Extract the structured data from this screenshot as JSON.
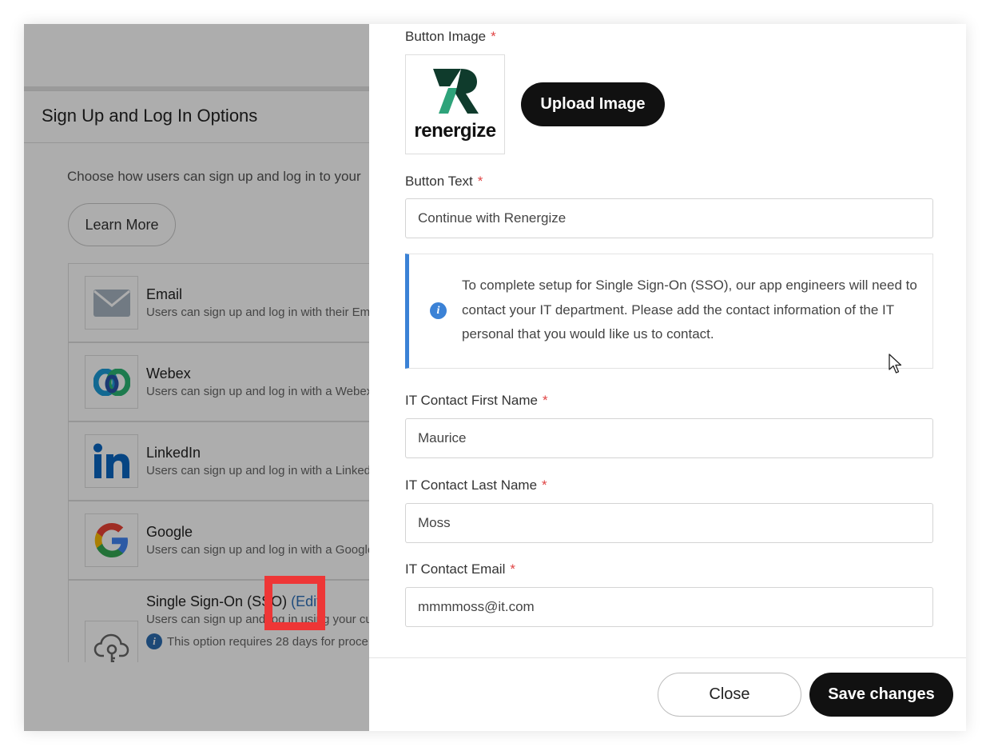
{
  "background_page": {
    "card_title": "Sign Up and Log In Options",
    "description": "Choose how users can sign up and log in to your",
    "learn_more_label": "Learn More",
    "providers": [
      {
        "name": "Email",
        "description": "Users can sign up and log in with their Ema",
        "icon": "envelope-icon"
      },
      {
        "name": "Webex",
        "description": "Users can sign up and log in with a Webex",
        "icon": "webex-icon"
      },
      {
        "name": "LinkedIn",
        "description": "Users can sign up and log in with a Linked",
        "icon": "linkedin-icon"
      },
      {
        "name": "Google",
        "description": "Users can sign up and log in with a Google",
        "icon": "google-icon"
      }
    ],
    "sso": {
      "name": "Single Sign-On (SSO)",
      "edit_label": "(Edit)",
      "description": "Users can sign up and log in using your cu",
      "note": "This option requires 28 days for proce",
      "icon": "cloud-key-icon"
    }
  },
  "drawer": {
    "button_image_label": "Button Image",
    "brand_logo_text": "renergize",
    "upload_label": "Upload Image",
    "button_text_label": "Button Text",
    "button_text_value": "Continue with Renergize",
    "info_message": "To complete setup for Single Sign-On (SSO), our app engineers will need to contact your IT department. Please add the contact information of the IT personal that you would like us to contact.",
    "first_name_label": "IT Contact First Name",
    "first_name_value": "Maurice",
    "last_name_label": "IT Contact Last Name",
    "last_name_value": "Moss",
    "email_label": "IT Contact Email",
    "email_value": "mmmmoss@it.com",
    "required_mark": "*",
    "close_label": "Close",
    "save_label": "Save changes"
  },
  "colors": {
    "primary_button": "#111111",
    "info_accent": "#3b82d6",
    "required": "#e04444",
    "highlight": "#ee3636",
    "link": "#2d6fb8"
  }
}
